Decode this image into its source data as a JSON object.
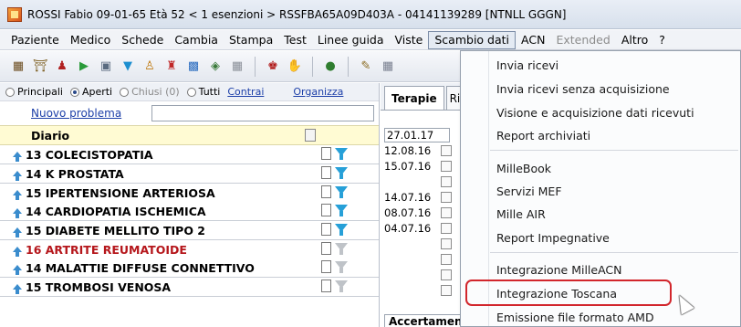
{
  "window": {
    "title": "ROSSI Fabio  09-01-65  Età 52  < 1 esenzioni > RSSFBA65A09D403A - 04141139289  [NTNLL GGGN]"
  },
  "menubar": {
    "items": [
      {
        "label": "Paziente"
      },
      {
        "label": "Medico"
      },
      {
        "label": "Schede"
      },
      {
        "label": "Cambia"
      },
      {
        "label": "Stampa"
      },
      {
        "label": "Test"
      },
      {
        "label": "Linee guida"
      },
      {
        "label": "Viste"
      },
      {
        "label": "Scambio dati"
      },
      {
        "label": "ACN"
      },
      {
        "label": "Extended"
      },
      {
        "label": "Altro"
      },
      {
        "label": "?"
      }
    ]
  },
  "filters": {
    "principali": "Principali",
    "aperti": "Aperti",
    "chiusi": "Chiusi (0)",
    "tutti": "Tutti",
    "contrai": "Contrai",
    "organizza": "Organizza"
  },
  "problems": {
    "new_link": "Nuovo problema",
    "new_input_value": "",
    "diario": "Diario",
    "items": [
      {
        "label": "13 COLECISTOPATIA"
      },
      {
        "label": "14 K PROSTATA"
      },
      {
        "label": "15 IPERTENSIONE ARTERIOSA"
      },
      {
        "label": "14 CARDIOPATIA ISCHEMICA"
      },
      {
        "label": "15 DIABETE MELLITO TIPO 2"
      },
      {
        "label": "16 ARTRITE REUMATOIDE"
      },
      {
        "label": "14 MALATTIE DIFFUSE CONNETTIVO"
      },
      {
        "label": "15 TROMBOSI VENOSA"
      }
    ]
  },
  "tabs": {
    "terapie": "Terapie",
    "ric": "Ric",
    "accertamenti": "Accertament"
  },
  "therapy_dates": [
    "27.01.17",
    "12.08.16",
    "15.07.16",
    "14.07.16",
    "08.07.16",
    "04.07.16"
  ],
  "dropdown": {
    "items": [
      {
        "label": "Invia ricevi"
      },
      {
        "label": "Invia ricevi senza acquisizione"
      },
      {
        "label": "Visione e acquisizione dati ricevuti"
      },
      {
        "label": "Report archiviati"
      },
      {
        "label": "MilleBook"
      },
      {
        "label": "Servizi MEF"
      },
      {
        "label": "Mille AIR"
      },
      {
        "label": "Report Impegnative"
      },
      {
        "label": "Integrazione MilleACN"
      },
      {
        "label": "Integrazione Toscana"
      },
      {
        "label": "Emissione file formato AMD"
      }
    ]
  },
  "colors": {
    "problem_red": "#b5161b",
    "highlight_ring": "#d2262c",
    "arrow_blue": "#3a8ccd",
    "diario_bg": "#fffbd3"
  }
}
